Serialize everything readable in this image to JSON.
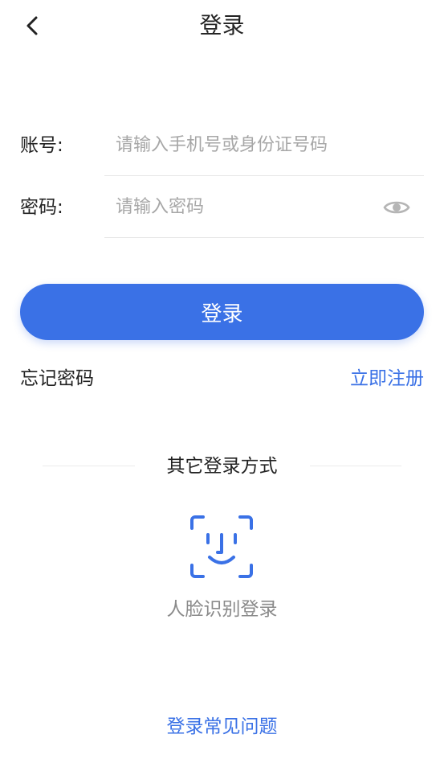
{
  "header": {
    "title": "登录",
    "back_icon": "chevron-left-icon"
  },
  "form": {
    "account": {
      "label": "账号:",
      "placeholder": "请输入手机号或身份证号码",
      "value": ""
    },
    "password": {
      "label": "密码:",
      "placeholder": "请输入密码",
      "value": "",
      "toggle_icon": "eye-icon"
    },
    "submit_label": "登录"
  },
  "links": {
    "forgot_password": "忘记密码",
    "register": "立即注册"
  },
  "other_login": {
    "title": "其它登录方式",
    "face_icon": "face-id-icon",
    "face_label": "人脸识别登录"
  },
  "footer": {
    "faq": "登录常见问题"
  },
  "colors": {
    "primary": "#3a71e6",
    "text": "#222222",
    "muted": "#8a8a8a",
    "placeholder": "#a7a7a7",
    "divider": "#e6e6e6"
  }
}
